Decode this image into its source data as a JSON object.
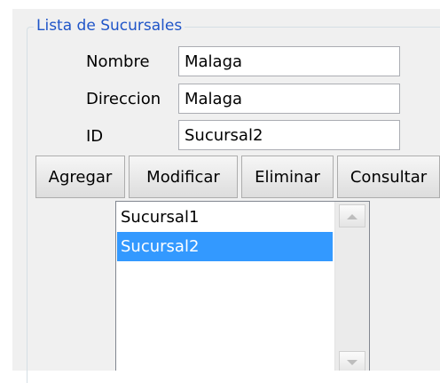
{
  "group": {
    "title": "Lista de Sucursales"
  },
  "form": {
    "nombre_label": "Nombre",
    "nombre_value": "Malaga",
    "direccion_label": "Direccion",
    "direccion_value": "Malaga",
    "id_label": "ID",
    "id_value": "Sucursal2"
  },
  "toolbar": {
    "agregar_label": "Agregar",
    "modificar_label": "Modificar",
    "eliminar_label": "Eliminar",
    "consultar_label": "Consultar"
  },
  "list": {
    "items": [
      {
        "label": "Sucursal1",
        "selected": false
      },
      {
        "label": "Sucursal2",
        "selected": true
      }
    ],
    "selected_color": "#3399ff"
  },
  "icons": {
    "scroll_up": "arrow-up-icon",
    "scroll_down": "arrow-down-icon"
  }
}
